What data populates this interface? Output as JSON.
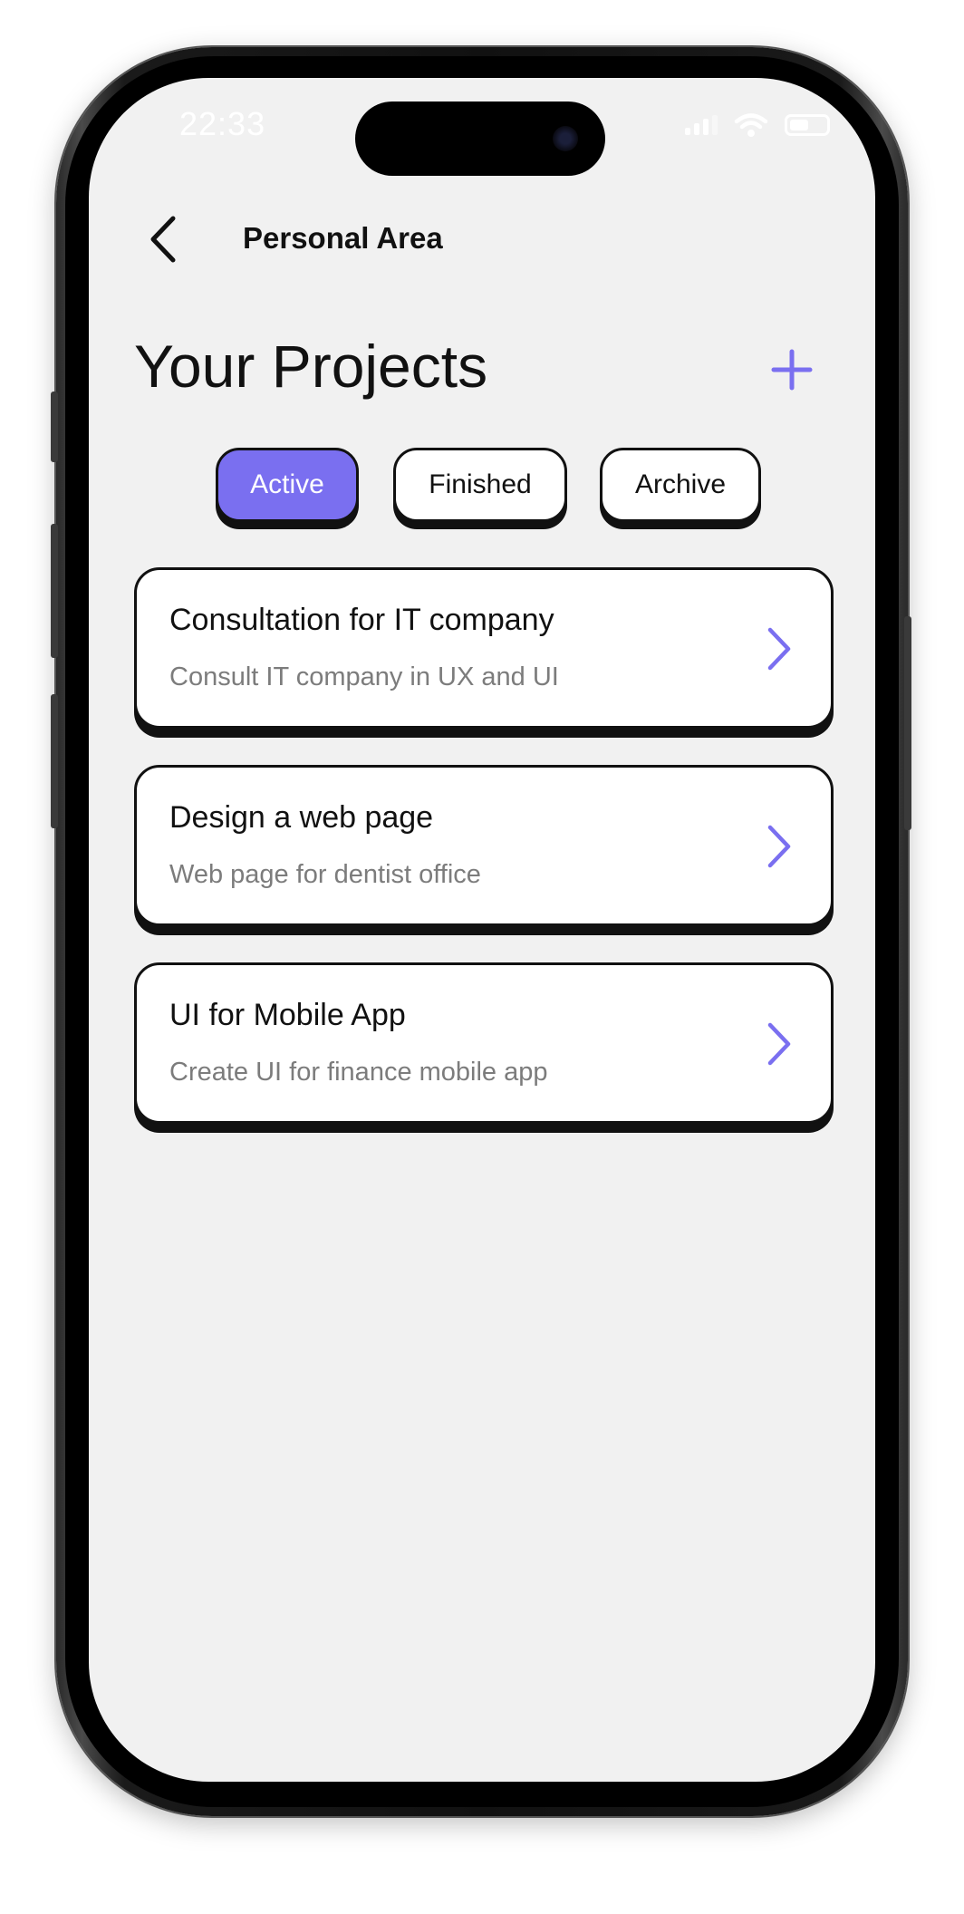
{
  "status_bar": {
    "time": "22:33"
  },
  "header": {
    "title": "Personal Area"
  },
  "page": {
    "title": "Your Projects"
  },
  "tabs": [
    {
      "label": "Active",
      "selected": true
    },
    {
      "label": "Finished",
      "selected": false
    },
    {
      "label": "Archive",
      "selected": false
    }
  ],
  "projects": [
    {
      "title": "Consultation for IT company",
      "subtitle": "Consult IT company in UX and UI"
    },
    {
      "title": "Design a web page",
      "subtitle": "Web page for dentist office"
    },
    {
      "title": "UI for Mobile App",
      "subtitle": "Create UI for finance mobile app"
    }
  ],
  "colors": {
    "accent": "#7a6ff0",
    "background": "#f1f1f1",
    "card": "#ffffff",
    "border": "#111111",
    "subtitle": "#7c7c7c"
  },
  "icons": {
    "back": "chevron-left-icon",
    "add": "plus-icon",
    "card_arrow": "chevron-right-icon"
  }
}
